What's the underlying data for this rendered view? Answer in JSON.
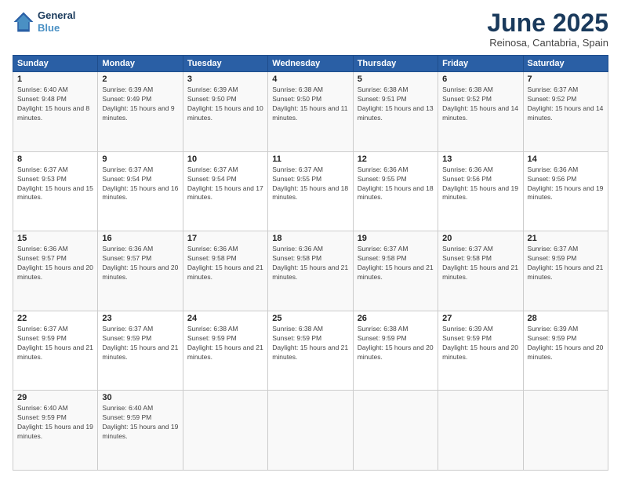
{
  "logo": {
    "line1": "General",
    "line2": "Blue"
  },
  "title": "June 2025",
  "subtitle": "Reinosa, Cantabria, Spain",
  "weekdays": [
    "Sunday",
    "Monday",
    "Tuesday",
    "Wednesday",
    "Thursday",
    "Friday",
    "Saturday"
  ],
  "weeks": [
    [
      {
        "day": "1",
        "sunrise": "6:40 AM",
        "sunset": "9:48 PM",
        "daylight": "15 hours and 8 minutes."
      },
      {
        "day": "2",
        "sunrise": "6:39 AM",
        "sunset": "9:49 PM",
        "daylight": "15 hours and 9 minutes."
      },
      {
        "day": "3",
        "sunrise": "6:39 AM",
        "sunset": "9:50 PM",
        "daylight": "15 hours and 10 minutes."
      },
      {
        "day": "4",
        "sunrise": "6:38 AM",
        "sunset": "9:50 PM",
        "daylight": "15 hours and 11 minutes."
      },
      {
        "day": "5",
        "sunrise": "6:38 AM",
        "sunset": "9:51 PM",
        "daylight": "15 hours and 13 minutes."
      },
      {
        "day": "6",
        "sunrise": "6:38 AM",
        "sunset": "9:52 PM",
        "daylight": "15 hours and 14 minutes."
      },
      {
        "day": "7",
        "sunrise": "6:37 AM",
        "sunset": "9:52 PM",
        "daylight": "15 hours and 14 minutes."
      }
    ],
    [
      {
        "day": "8",
        "sunrise": "6:37 AM",
        "sunset": "9:53 PM",
        "daylight": "15 hours and 15 minutes."
      },
      {
        "day": "9",
        "sunrise": "6:37 AM",
        "sunset": "9:54 PM",
        "daylight": "15 hours and 16 minutes."
      },
      {
        "day": "10",
        "sunrise": "6:37 AM",
        "sunset": "9:54 PM",
        "daylight": "15 hours and 17 minutes."
      },
      {
        "day": "11",
        "sunrise": "6:37 AM",
        "sunset": "9:55 PM",
        "daylight": "15 hours and 18 minutes."
      },
      {
        "day": "12",
        "sunrise": "6:36 AM",
        "sunset": "9:55 PM",
        "daylight": "15 hours and 18 minutes."
      },
      {
        "day": "13",
        "sunrise": "6:36 AM",
        "sunset": "9:56 PM",
        "daylight": "15 hours and 19 minutes."
      },
      {
        "day": "14",
        "sunrise": "6:36 AM",
        "sunset": "9:56 PM",
        "daylight": "15 hours and 19 minutes."
      }
    ],
    [
      {
        "day": "15",
        "sunrise": "6:36 AM",
        "sunset": "9:57 PM",
        "daylight": "15 hours and 20 minutes."
      },
      {
        "day": "16",
        "sunrise": "6:36 AM",
        "sunset": "9:57 PM",
        "daylight": "15 hours and 20 minutes."
      },
      {
        "day": "17",
        "sunrise": "6:36 AM",
        "sunset": "9:58 PM",
        "daylight": "15 hours and 21 minutes."
      },
      {
        "day": "18",
        "sunrise": "6:36 AM",
        "sunset": "9:58 PM",
        "daylight": "15 hours and 21 minutes."
      },
      {
        "day": "19",
        "sunrise": "6:37 AM",
        "sunset": "9:58 PM",
        "daylight": "15 hours and 21 minutes."
      },
      {
        "day": "20",
        "sunrise": "6:37 AM",
        "sunset": "9:58 PM",
        "daylight": "15 hours and 21 minutes."
      },
      {
        "day": "21",
        "sunrise": "6:37 AM",
        "sunset": "9:59 PM",
        "daylight": "15 hours and 21 minutes."
      }
    ],
    [
      {
        "day": "22",
        "sunrise": "6:37 AM",
        "sunset": "9:59 PM",
        "daylight": "15 hours and 21 minutes."
      },
      {
        "day": "23",
        "sunrise": "6:37 AM",
        "sunset": "9:59 PM",
        "daylight": "15 hours and 21 minutes."
      },
      {
        "day": "24",
        "sunrise": "6:38 AM",
        "sunset": "9:59 PM",
        "daylight": "15 hours and 21 minutes."
      },
      {
        "day": "25",
        "sunrise": "6:38 AM",
        "sunset": "9:59 PM",
        "daylight": "15 hours and 21 minutes."
      },
      {
        "day": "26",
        "sunrise": "6:38 AM",
        "sunset": "9:59 PM",
        "daylight": "15 hours and 20 minutes."
      },
      {
        "day": "27",
        "sunrise": "6:39 AM",
        "sunset": "9:59 PM",
        "daylight": "15 hours and 20 minutes."
      },
      {
        "day": "28",
        "sunrise": "6:39 AM",
        "sunset": "9:59 PM",
        "daylight": "15 hours and 20 minutes."
      }
    ],
    [
      {
        "day": "29",
        "sunrise": "6:40 AM",
        "sunset": "9:59 PM",
        "daylight": "15 hours and 19 minutes."
      },
      {
        "day": "30",
        "sunrise": "6:40 AM",
        "sunset": "9:59 PM",
        "daylight": "15 hours and 19 minutes."
      },
      null,
      null,
      null,
      null,
      null
    ]
  ]
}
